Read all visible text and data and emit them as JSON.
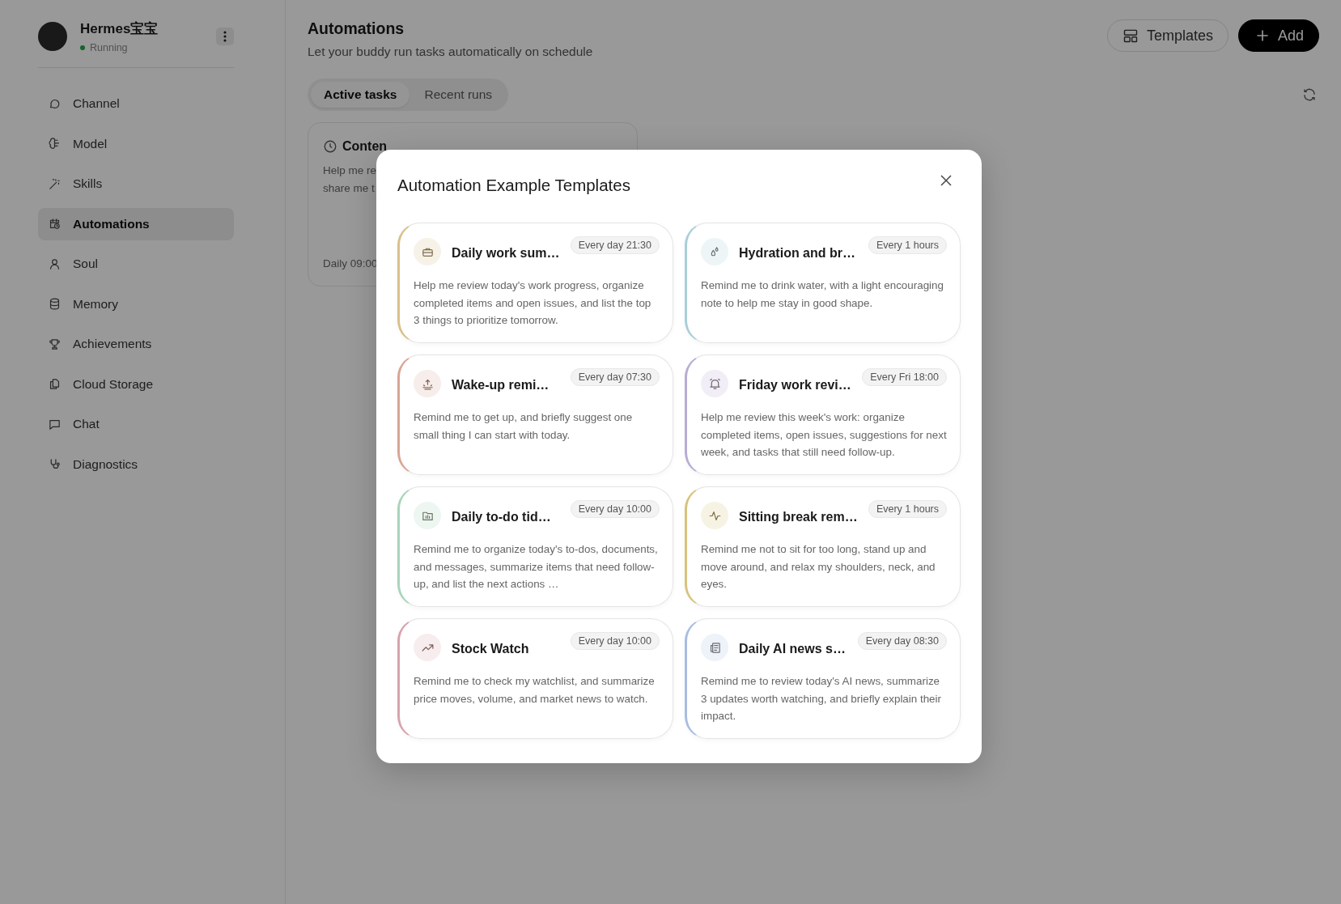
{
  "sidebar": {
    "profile": {
      "name": "Hermes宝宝",
      "status": "Running"
    },
    "items": [
      {
        "label": "Channel",
        "selected": false
      },
      {
        "label": "Model",
        "selected": false
      },
      {
        "label": "Skills",
        "selected": false
      },
      {
        "label": "Automations",
        "selected": true
      },
      {
        "label": "Soul",
        "selected": false
      },
      {
        "label": "Memory",
        "selected": false
      },
      {
        "label": "Achievements",
        "selected": false
      },
      {
        "label": "Cloud Storage",
        "selected": false
      },
      {
        "label": "Chat",
        "selected": false
      },
      {
        "label": "Diagnostics",
        "selected": false
      }
    ]
  },
  "header": {
    "title": "Automations",
    "subtitle": "Let your buddy run tasks automatically on schedule",
    "buttons": [
      {
        "label": "Templates",
        "kind": "outline"
      },
      {
        "label": "Add",
        "kind": "primary"
      }
    ]
  },
  "tabs": [
    {
      "label": "Active tasks",
      "selected": true
    },
    {
      "label": "Recent runs",
      "selected": false
    }
  ],
  "task_card": {
    "title": "Conten",
    "description": [
      "Help me re",
      "share me t"
    ],
    "schedule": "Daily 09:00"
  },
  "modal": {
    "title": "Automation Example Templates",
    "templates": [
      {
        "title": "Daily work sum…",
        "schedule": "Every day 21:30",
        "description": "Help me review today's work progress, organize completed items and open issues, and list the top 3 things to prioritize tomorrow.",
        "color": "#d9c08a"
      },
      {
        "title": "Hydration and br…",
        "schedule": "Every 1 hours",
        "description": "Remind me to drink water, with a light encouraging note to help me stay in good shape.",
        "color": "#a9cfd8"
      },
      {
        "title": "Wake-up remi…",
        "schedule": "Every day 07:30",
        "description": "Remind me to get up, and briefly suggest one small thing I can start with today.",
        "color": "#d9a594"
      },
      {
        "title": "Friday work revi…",
        "schedule": "Every Fri 18:00",
        "description": "Help me review this week's work: organize completed items, open issues, suggestions for next week, and tasks that still need follow-up.",
        "color": "#b8acd6"
      },
      {
        "title": "Daily to-do tid…",
        "schedule": "Every day 10:00",
        "description": "Remind me to organize today's to-dos, documents, and messages, summarize items that need follow-up, and list the next actions …",
        "color": "#a9d4bd"
      },
      {
        "title": "Sitting break rem…",
        "schedule": "Every 1 hours",
        "description": "Remind me not to sit for too long, stand up and move around, and relax my shoulders, neck, and eyes.",
        "color": "#d8c27a"
      },
      {
        "title": "Stock Watch",
        "schedule": "Every day 10:00",
        "description": "Remind me to check my watchlist, and summarize price moves, volume, and market news to watch.",
        "color": "#d8a3ab"
      },
      {
        "title": "Daily AI news s…",
        "schedule": "Every day 08:30",
        "description": "Remind me to review today's AI news, summarize 3 updates worth watching, and briefly explain their impact.",
        "color": "#a8bde0"
      }
    ]
  }
}
